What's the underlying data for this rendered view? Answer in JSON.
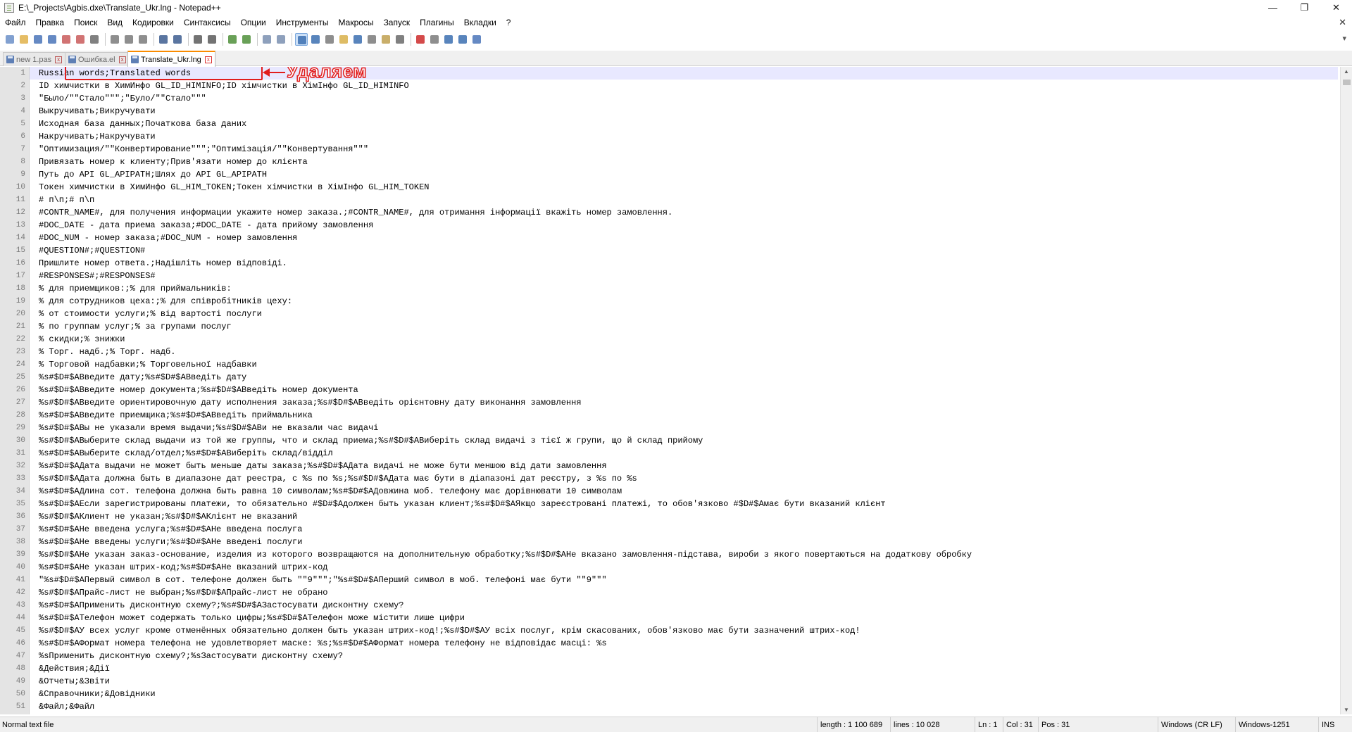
{
  "window": {
    "title": "E:\\_Projects\\Agbis.dxe\\Translate_Ukr.lng - Notepad++",
    "min": "—",
    "max": "❐",
    "close": "✕"
  },
  "menu": [
    "Файл",
    "Правка",
    "Поиск",
    "Вид",
    "Кодировки",
    "Синтаксисы",
    "Опции",
    "Инструменты",
    "Макросы",
    "Запуск",
    "Плагины",
    "Вкладки",
    "?"
  ],
  "menu_close": "✕",
  "toolbar_end": "▾",
  "tabs": [
    {
      "label": "new 1.pas",
      "close": "x"
    },
    {
      "label": "Ошибка.el",
      "close": "x"
    },
    {
      "label": "Translate_Ukr.lng",
      "close": "x"
    }
  ],
  "annotation": {
    "label": "Удаляем"
  },
  "scrollbar": {
    "up": "▲",
    "down": "▼"
  },
  "lines": [
    {
      "n": "1",
      "t": "Russian words;Translated words"
    },
    {
      "n": "2",
      "t": "ID химчистки в ХимИнфо GL_ID_HIMINFO;ID хімчистки в ХімІнфо GL_ID_HIMINFO"
    },
    {
      "n": "3",
      "t": "\"Было/\"\"Стало\"\"\";\"Було/\"\"Стало\"\"\""
    },
    {
      "n": "4",
      "t": "Выкручивать;Викручувати"
    },
    {
      "n": "5",
      "t": "Исходная база данных;Початкова база даних"
    },
    {
      "n": "6",
      "t": "Накручивать;Накручувати"
    },
    {
      "n": "7",
      "t": "\"Оптимизация/\"\"Конвертирование\"\"\";\"Оптимізація/\"\"Конвертування\"\"\""
    },
    {
      "n": "8",
      "t": "Привязать номер к клиенту;Прив'язати номер до клієнта"
    },
    {
      "n": "9",
      "t": "Путь до API GL_APIPATH;Шлях до API GL_APIPATH"
    },
    {
      "n": "10",
      "t": "Токен химчистки в ХимИнфо GL_HIM_TOKEN;Токен хімчистки в ХімІнфо GL_HIM_TOKEN"
    },
    {
      "n": "11",
      "t": "# п\\п;# п\\п"
    },
    {
      "n": "12",
      "t": "#CONTR_NAME#, для получения информации укажите номер заказа.;#CONTR_NAME#, для отримання інформації вкажіть номер замовлення."
    },
    {
      "n": "13",
      "t": "#DOC_DATE - дата приема заказа;#DOC_DATE - дата прийому замовлення"
    },
    {
      "n": "14",
      "t": "#DOC_NUM - номер заказа;#DOC_NUM - номер замовлення"
    },
    {
      "n": "15",
      "t": "#QUESTION#;#QUESTION#"
    },
    {
      "n": "16",
      "t": "Пришлите номер ответа.;Надішліть номер відповіді."
    },
    {
      "n": "17",
      "t": "#RESPONSES#;#RESPONSES#"
    },
    {
      "n": "18",
      "t": "% для приемщиков:;% для приймальників:"
    },
    {
      "n": "19",
      "t": "% для сотрудников цеха:;% для співробітників цеху:"
    },
    {
      "n": "20",
      "t": "% от стоимости услуги;% від вартості послуги"
    },
    {
      "n": "21",
      "t": "% по группам услуг;% за групами послуг"
    },
    {
      "n": "22",
      "t": "% скидки;% знижки"
    },
    {
      "n": "23",
      "t": "% Торг. надб.;% Торг. надб."
    },
    {
      "n": "24",
      "t": "% Торговой надбавки;% Торговельної надбавки"
    },
    {
      "n": "25",
      "t": "%s#$D#$AВведите дату;%s#$D#$AВведіть дату"
    },
    {
      "n": "26",
      "t": "%s#$D#$AВведите номер документа;%s#$D#$AВведіть номер документа"
    },
    {
      "n": "27",
      "t": "%s#$D#$AВведите ориентировочную дату исполнения заказа;%s#$D#$AВведіть орієнтовну дату виконання замовлення"
    },
    {
      "n": "28",
      "t": "%s#$D#$AВведите приемщика;%s#$D#$AВведіть приймальника"
    },
    {
      "n": "29",
      "t": "%s#$D#$AВы не указали время выдачи;%s#$D#$AВи не вказали час видачі"
    },
    {
      "n": "30",
      "t": "%s#$D#$AВыберите склад выдачи из той же группы, что и склад приема;%s#$D#$AВиберіть склад видачі з тієї ж групи, що й склад прийому"
    },
    {
      "n": "31",
      "t": "%s#$D#$AВыберите склад/отдел;%s#$D#$AВиберіть склад/відділ"
    },
    {
      "n": "32",
      "t": "%s#$D#$AДата выдачи не может быть меньше даты заказа;%s#$D#$AДата видачі не може бути меншою від дати замовлення"
    },
    {
      "n": "33",
      "t": "%s#$D#$AДата должна быть в диапазоне дат реестра, с %s по %s;%s#$D#$AДата має бути в діапазоні дат реєстру, з %s по %s"
    },
    {
      "n": "34",
      "t": "%s#$D#$AДлина сот. телефона должна быть равна 10 символам;%s#$D#$AДовжина моб. телефону має дорівнювати 10 символам"
    },
    {
      "n": "35",
      "t": "%s#$D#$AЕсли зарегистрированы платежи, то обязательно #$D#$Aдолжен быть указан клиент;%s#$D#$AЯкщо зареєстровані платежі, то обов'язково #$D#$Aмає бути вказаний клієнт"
    },
    {
      "n": "36",
      "t": "%s#$D#$AКлиент не указан;%s#$D#$AКлієнт не вказаний"
    },
    {
      "n": "37",
      "t": "%s#$D#$AНе введена услуга;%s#$D#$AНе введена послуга"
    },
    {
      "n": "38",
      "t": "%s#$D#$AНе введены услуги;%s#$D#$AНе введені послуги"
    },
    {
      "n": "39",
      "t": "%s#$D#$AНе указан заказ-основание, изделия из которого возвращаются на дополнительную обработку;%s#$D#$AНе вказано замовлення-підстава, вироби з якого повертаються на додаткову обробку"
    },
    {
      "n": "40",
      "t": "%s#$D#$AНе указан штрих-код;%s#$D#$AНе вказаний штрих-код"
    },
    {
      "n": "41",
      "t": "\"%s#$D#$AПервый символ в сот. телефоне должен быть \"\"9\"\"\";\"%s#$D#$AПерший символ в моб. телефоні має бути \"\"9\"\"\""
    },
    {
      "n": "42",
      "t": "%s#$D#$AПрайс-лист не выбран;%s#$D#$AПрайс-лист не обрано"
    },
    {
      "n": "43",
      "t": "%s#$D#$AПрименить дисконтную схему?;%s#$D#$AЗастосувати дисконтну схему?"
    },
    {
      "n": "44",
      "t": "%s#$D#$AТелефон может содержать только цифры;%s#$D#$AТелефон може містити лише цифри"
    },
    {
      "n": "45",
      "t": "%s#$D#$AУ всех услуг кроме отменённых обязательно должен быть указан штрих-код!;%s#$D#$AУ всіх послуг, крім скасованих, обов'язково має бути зазначений штрих-код!"
    },
    {
      "n": "46",
      "t": "%s#$D#$AФормат номера телефона не удовлетворяет маске: %s;%s#$D#$AФормат номера телефону не відповідає масці: %s"
    },
    {
      "n": "47",
      "t": "%sПрименить дисконтную схему?;%sЗастосувати дисконтну схему?"
    },
    {
      "n": "48",
      "t": "&Действия;&Дії"
    },
    {
      "n": "49",
      "t": "&Отчеты;&Звіти"
    },
    {
      "n": "50",
      "t": "&Справочники;&Довідники"
    },
    {
      "n": "51",
      "t": "&Файл;&Файл"
    }
  ],
  "status": {
    "type": "Normal text file",
    "length": "length : 1 100 689",
    "lines": "lines : 10 028",
    "ln": "Ln : 1",
    "col": "Col : 31",
    "pos": "Pos : 31",
    "eol": "Windows (CR LF)",
    "encoding": "Windows-1251",
    "mode": "INS"
  },
  "colors": {
    "accent_tab": "#fa8c00",
    "annotation": "#e11d1d",
    "current_line": "#e8e8ff"
  },
  "toolbar_icons": [
    "new-file-icon",
    "open-file-icon",
    "save-icon",
    "save-all-icon",
    "close-icon",
    "close-all-icon",
    "print-icon",
    "cut-icon",
    "copy-icon",
    "paste-icon",
    "undo-icon",
    "redo-icon",
    "find-icon",
    "replace-icon",
    "zoom-in-icon",
    "zoom-out-icon",
    "sync-vertical-icon",
    "sync-horizontal-icon",
    "word-wrap-icon",
    "show-all-chars-icon",
    "indent-guide-icon",
    "udl-icon",
    "doc-map-icon",
    "function-list-icon",
    "folder-workspace-icon",
    "monitoring-icon",
    "record-macro-icon",
    "stop-macro-icon",
    "play-macro-icon",
    "run-macro-multiple-icon",
    "save-macro-icon"
  ]
}
